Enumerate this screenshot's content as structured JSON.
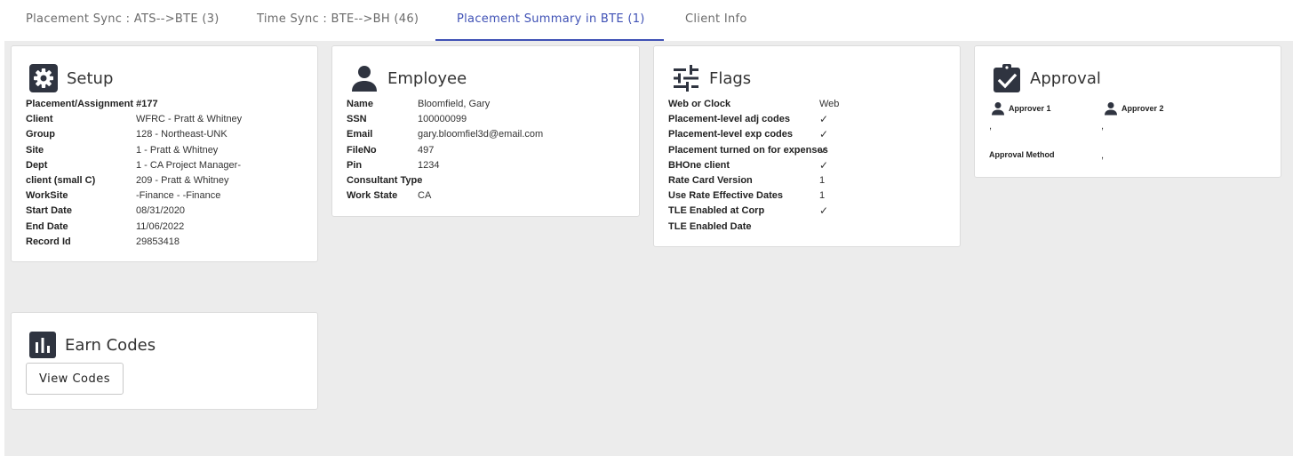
{
  "tabs": [
    {
      "label": "Placement Sync : ATS-->BTE (3)"
    },
    {
      "label": "Time Sync : BTE-->BH (46)"
    },
    {
      "label": "Placement Summary in BTE (1)"
    },
    {
      "label": "Client Info"
    }
  ],
  "active_tab_index": 2,
  "accent_color": "#3f51b5",
  "setup": {
    "icon": "gear-icon",
    "title": "Setup",
    "rows": [
      {
        "label": "Placement/Assignment #177",
        "value": ""
      },
      {
        "label": "Client",
        "value": "WFRC - Pratt & Whitney"
      },
      {
        "label": "Group",
        "value": "128 - Northeast-UNK"
      },
      {
        "label": "Site",
        "value": "1 - Pratt & Whitney"
      },
      {
        "label": "Dept",
        "value": "1 - CA Project Manager-"
      },
      {
        "label": "client (small C)",
        "value": "209 - Pratt & Whitney"
      },
      {
        "label": "WorkSite",
        "value": "-Finance - -Finance"
      },
      {
        "label": "Start Date",
        "value": "08/31/2020"
      },
      {
        "label": "End Date",
        "value": "11/06/2022"
      },
      {
        "label": "Record Id",
        "value": "29853418"
      }
    ]
  },
  "employee": {
    "icon": "person-icon",
    "title": "Employee",
    "rows": [
      {
        "label": "Name",
        "value": "Bloomfield, Gary"
      },
      {
        "label": "SSN",
        "value": "100000099"
      },
      {
        "label": "Email",
        "value": "gary.bloomfiel3d@email.com"
      },
      {
        "label": "FileNo",
        "value": "497"
      },
      {
        "label": "Pin",
        "value": "1234"
      },
      {
        "label": "Consultant Type",
        "value": ""
      },
      {
        "label": "Work State",
        "value": "CA"
      }
    ]
  },
  "flags": {
    "icon": "sliders-icon",
    "title": "Flags",
    "check_color": "#2e9e5b",
    "rows": [
      {
        "label": "Web or Clock",
        "value": "Web"
      },
      {
        "label": "Placement-level adj codes",
        "value": "✓"
      },
      {
        "label": "Placement-level exp codes",
        "value": "✓"
      },
      {
        "label": "Placement turned on for expenses",
        "value": "✓"
      },
      {
        "label": "BHOne client",
        "value": "✓"
      },
      {
        "label": "Rate Card Version",
        "value": "1"
      },
      {
        "label": "Use Rate Effective Dates",
        "value": "1"
      },
      {
        "label": "TLE Enabled at Corp",
        "value": "✓"
      },
      {
        "label": "TLE Enabled Date",
        "value": ""
      }
    ]
  },
  "approval": {
    "icon": "clipboard-check-icon",
    "title": "Approval",
    "approver1_label": "Approver 1",
    "approver2_label": "Approver 2",
    "approver1_value": ",",
    "approver2_value": ",",
    "method_label": "Approval Method",
    "method_value": ","
  },
  "earn_codes": {
    "icon": "bar-chart-icon",
    "title": "Earn Codes",
    "button_label": "View Codes"
  }
}
